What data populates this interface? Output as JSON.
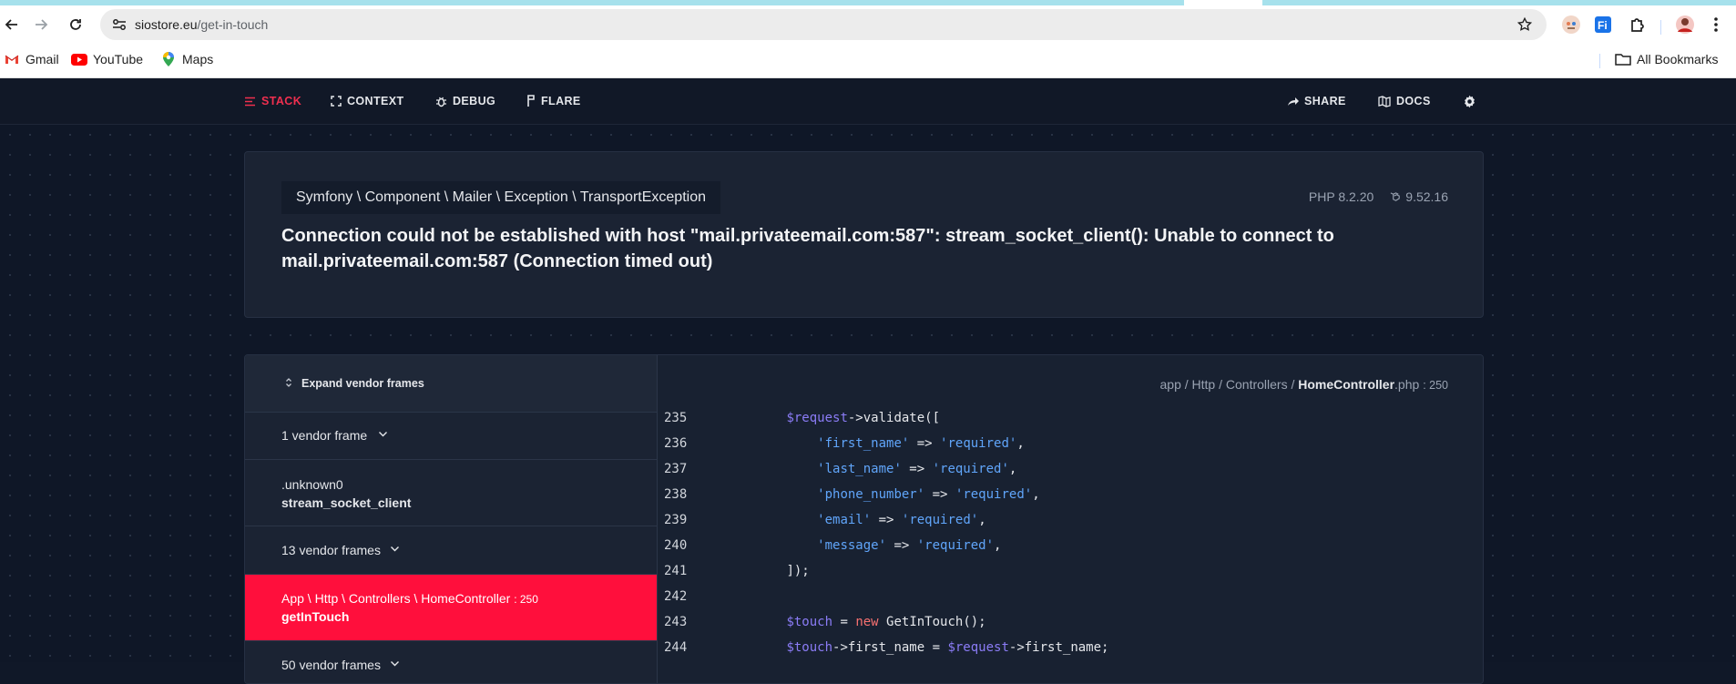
{
  "browser": {
    "url_host": "siostore.eu",
    "url_path": "/get-in-touch",
    "bookmarks": [
      {
        "label": "Gmail",
        "icon": "gmail-icon"
      },
      {
        "label": "YouTube",
        "icon": "youtube-icon"
      },
      {
        "label": "Maps",
        "icon": "maps-icon"
      }
    ],
    "all_bookmarks_label": "All Bookmarks"
  },
  "nav": {
    "left": [
      {
        "label": "STACK",
        "icon": "stack-icon",
        "active": true
      },
      {
        "label": "CONTEXT",
        "icon": "context-icon",
        "active": false
      },
      {
        "label": "DEBUG",
        "icon": "bug-icon",
        "active": false
      },
      {
        "label": "FLARE",
        "icon": "flare-icon",
        "active": false
      }
    ],
    "right": [
      {
        "label": "SHARE",
        "icon": "share-icon"
      },
      {
        "label": "DOCS",
        "icon": "docs-icon"
      }
    ],
    "settings_icon": "gear-icon",
    "accent_color": "#ef2f4f"
  },
  "error": {
    "exception_class": "Symfony \\ Component \\ Mailer \\ Exception \\ TransportException",
    "php_version": "PHP 8.2.20",
    "laravel_version": "9.52.16",
    "message": "Connection could not be established with host \"mail.privateemail.com:587\": stream_socket_client(): Unable to connect to mail.privateemail.com:587 (Connection timed out)"
  },
  "frames": {
    "expand_label": "Expand vendor frames",
    "vendor_1": "1 vendor frame",
    "unknown_class": ".unknown0",
    "unknown_fn": "stream_socket_client",
    "vendor_13": "13 vendor frames",
    "active_class": "App \\ Http \\ Controllers \\ HomeController",
    "active_line": ": 250",
    "active_fn": "getInTouch",
    "vendor_50": "50 vendor frames",
    "active_color": "#ff0f3c"
  },
  "code": {
    "path_prefix": "app / Http / Controllers / ",
    "file_name": "HomeController",
    "file_ext": ".php",
    "line": ": 250",
    "lines": [
      {
        "n": "235",
        "tokens": [
          [
            "ws",
            "        "
          ],
          [
            "var",
            "$request"
          ],
          [
            "op",
            "->validate(["
          ]
        ]
      },
      {
        "n": "236",
        "tokens": [
          [
            "ws",
            "            "
          ],
          [
            "str",
            "'first_name'"
          ],
          [
            "op",
            " => "
          ],
          [
            "str",
            "'required'"
          ],
          [
            "op",
            ","
          ]
        ]
      },
      {
        "n": "237",
        "tokens": [
          [
            "ws",
            "            "
          ],
          [
            "str",
            "'last_name'"
          ],
          [
            "op",
            " => "
          ],
          [
            "str",
            "'required'"
          ],
          [
            "op",
            ","
          ]
        ]
      },
      {
        "n": "238",
        "tokens": [
          [
            "ws",
            "            "
          ],
          [
            "str",
            "'phone_number'"
          ],
          [
            "op",
            " => "
          ],
          [
            "str",
            "'required'"
          ],
          [
            "op",
            ","
          ]
        ]
      },
      {
        "n": "239",
        "tokens": [
          [
            "ws",
            "            "
          ],
          [
            "str",
            "'email'"
          ],
          [
            "op",
            " => "
          ],
          [
            "str",
            "'required'"
          ],
          [
            "op",
            ","
          ]
        ]
      },
      {
        "n": "240",
        "tokens": [
          [
            "ws",
            "            "
          ],
          [
            "str",
            "'message'"
          ],
          [
            "op",
            " => "
          ],
          [
            "str",
            "'required'"
          ],
          [
            "op",
            ","
          ]
        ]
      },
      {
        "n": "241",
        "tokens": [
          [
            "ws",
            "        "
          ],
          [
            "op",
            "]);"
          ]
        ]
      },
      {
        "n": "242",
        "tokens": []
      },
      {
        "n": "243",
        "tokens": [
          [
            "ws",
            "        "
          ],
          [
            "var",
            "$touch"
          ],
          [
            "op",
            " = "
          ],
          [
            "kw",
            "new"
          ],
          [
            "op",
            " GetInTouch();"
          ]
        ]
      },
      {
        "n": "244",
        "tokens": [
          [
            "ws",
            "        "
          ],
          [
            "var",
            "$touch"
          ],
          [
            "op",
            "->first_name = "
          ],
          [
            "var",
            "$request"
          ],
          [
            "op",
            "->first_name;"
          ]
        ]
      }
    ]
  }
}
